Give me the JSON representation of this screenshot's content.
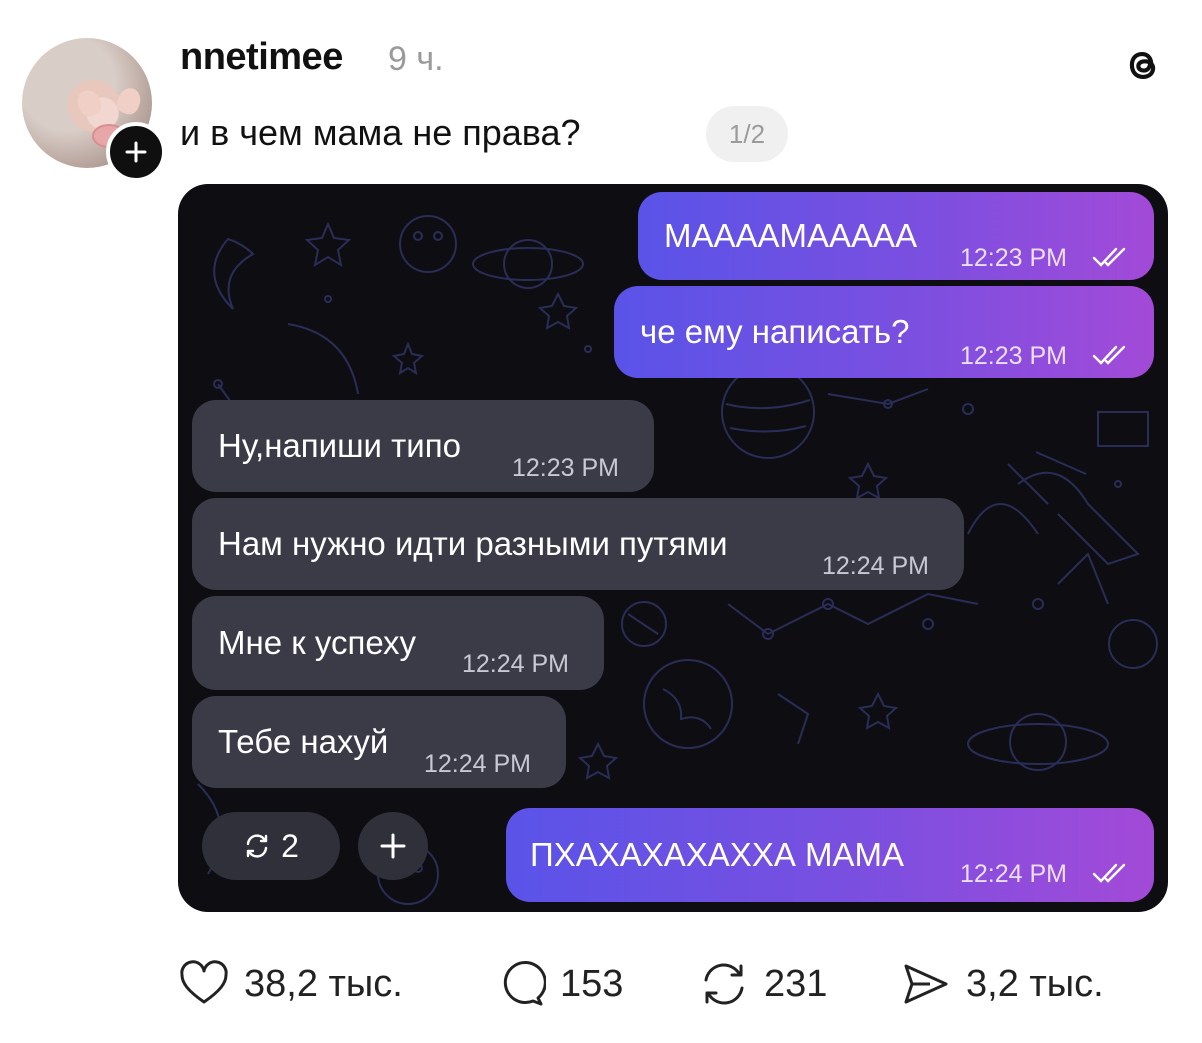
{
  "post": {
    "username": "nnetimee",
    "time_ago": "9 ч.",
    "text": "и в чем мама не права?",
    "page_indicator": "1/2"
  },
  "chat": {
    "messages": [
      {
        "side": "out",
        "text": "МААААМААААА",
        "time": "12:23 PM",
        "read": true
      },
      {
        "side": "out",
        "text": "че ему написать?",
        "time": "12:23 PM",
        "read": true
      },
      {
        "side": "in",
        "text": "Ну,напиши типо",
        "time": "12:23 PM"
      },
      {
        "side": "in",
        "text": "Нам нужно идти разными путями",
        "time": "12:24 PM"
      },
      {
        "side": "in",
        "text": "Мне к успеху",
        "time": "12:24 PM"
      },
      {
        "side": "in",
        "text": "Тебе нахуй",
        "time": "12:24 PM"
      },
      {
        "side": "out",
        "text": "ПХАХАХАХАХХА МАМА",
        "time": "12:24 PM",
        "read": true
      }
    ],
    "repost_count": "2"
  },
  "actions": {
    "likes": "38,2 тыс.",
    "comments": "153",
    "reposts": "231",
    "shares": "3,2 тыс."
  },
  "colors": {
    "outgoing_start": "#5a53e8",
    "outgoing_end": "#a34ad8",
    "incoming": "#3a3b47",
    "chat_background": "#0d0d12"
  },
  "icons": [
    "plus-icon",
    "threads-logo-icon",
    "heart-icon",
    "comment-icon",
    "repost-icon",
    "share-icon",
    "double-check-icon"
  ]
}
